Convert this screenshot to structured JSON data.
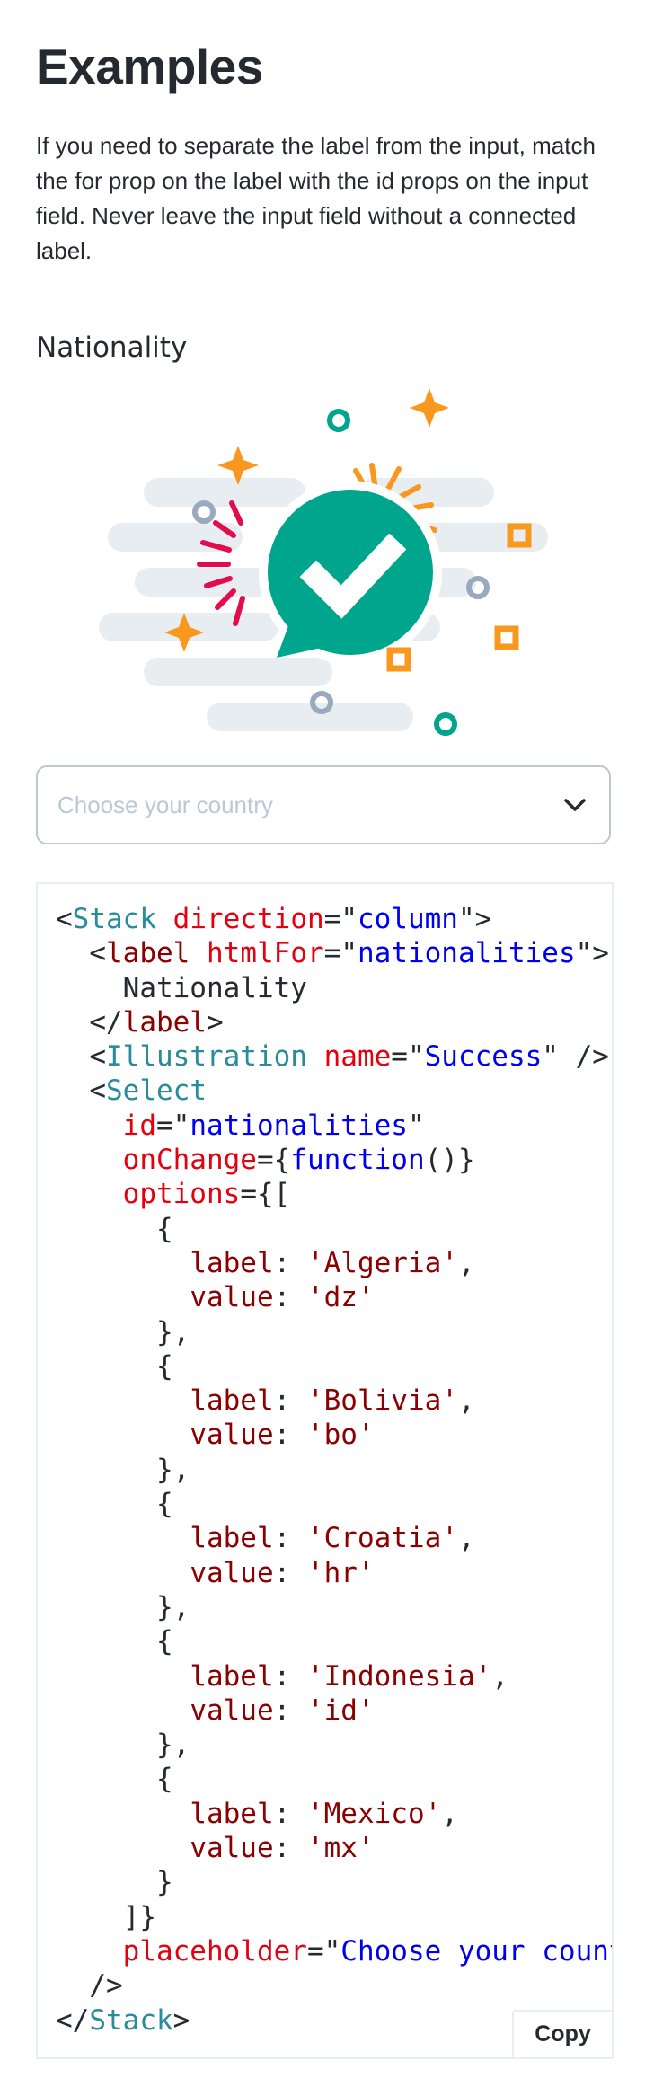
{
  "page": {
    "heading": "Examples",
    "intro": "If you need to separate the label from the input, match the for prop on the label with the id props on the input field. Never leave the input field without a connected label."
  },
  "example": {
    "label": "Nationality",
    "illustration_name": "success-illustration",
    "select": {
      "placeholder": "Choose your country",
      "icon": "chevron-down-icon"
    }
  },
  "code": {
    "copy_label": "Copy",
    "lines": [
      [
        [
          "p",
          "<"
        ],
        [
          "t",
          "Stack"
        ],
        [
          "p",
          " "
        ],
        [
          "a",
          "direction"
        ],
        [
          "p",
          "=\""
        ],
        [
          "s",
          "column"
        ],
        [
          "p",
          "\">"
        ]
      ],
      [
        [
          "p",
          "  <"
        ],
        [
          "q",
          "label"
        ],
        [
          "p",
          " "
        ],
        [
          "a",
          "htmlFor"
        ],
        [
          "p",
          "=\""
        ],
        [
          "s",
          "nationalities"
        ],
        [
          "p",
          "\">"
        ]
      ],
      [
        [
          "p",
          "    Nationality"
        ]
      ],
      [
        [
          "p",
          "  </"
        ],
        [
          "q",
          "label"
        ],
        [
          "p",
          ">"
        ]
      ],
      [
        [
          "p",
          "  <"
        ],
        [
          "t",
          "Illustration"
        ],
        [
          "p",
          " "
        ],
        [
          "a",
          "name"
        ],
        [
          "p",
          "=\""
        ],
        [
          "s",
          "Success"
        ],
        [
          "p",
          "\" />"
        ]
      ],
      [
        [
          "p",
          "  <"
        ],
        [
          "t",
          "Select"
        ]
      ],
      [
        [
          "p",
          "    "
        ],
        [
          "a",
          "id"
        ],
        [
          "p",
          "=\""
        ],
        [
          "s",
          "nationalities"
        ],
        [
          "p",
          "\""
        ]
      ],
      [
        [
          "p",
          "    "
        ],
        [
          "a",
          "onChange"
        ],
        [
          "p",
          "={"
        ],
        [
          "s",
          "function"
        ],
        [
          "p",
          "()}"
        ]
      ],
      [
        [
          "p",
          "    "
        ],
        [
          "a",
          "options"
        ],
        [
          "p",
          "={["
        ]
      ],
      [
        [
          "p",
          "      {"
        ]
      ],
      [
        [
          "p",
          "        "
        ],
        [
          "q",
          "label"
        ],
        [
          "p",
          ": "
        ],
        [
          "q",
          "'Algeria'"
        ],
        [
          "p",
          ","
        ]
      ],
      [
        [
          "p",
          "        "
        ],
        [
          "q",
          "value"
        ],
        [
          "p",
          ": "
        ],
        [
          "q",
          "'dz'"
        ]
      ],
      [
        [
          "p",
          "      },"
        ]
      ],
      [
        [
          "p",
          "      {"
        ]
      ],
      [
        [
          "p",
          "        "
        ],
        [
          "q",
          "label"
        ],
        [
          "p",
          ": "
        ],
        [
          "q",
          "'Bolivia'"
        ],
        [
          "p",
          ","
        ]
      ],
      [
        [
          "p",
          "        "
        ],
        [
          "q",
          "value"
        ],
        [
          "p",
          ": "
        ],
        [
          "q",
          "'bo'"
        ]
      ],
      [
        [
          "p",
          "      },"
        ]
      ],
      [
        [
          "p",
          "      {"
        ]
      ],
      [
        [
          "p",
          "        "
        ],
        [
          "q",
          "label"
        ],
        [
          "p",
          ": "
        ],
        [
          "q",
          "'Croatia'"
        ],
        [
          "p",
          ","
        ]
      ],
      [
        [
          "p",
          "        "
        ],
        [
          "q",
          "value"
        ],
        [
          "p",
          ": "
        ],
        [
          "q",
          "'hr'"
        ]
      ],
      [
        [
          "p",
          "      },"
        ]
      ],
      [
        [
          "p",
          "      {"
        ]
      ],
      [
        [
          "p",
          "        "
        ],
        [
          "q",
          "label"
        ],
        [
          "p",
          ": "
        ],
        [
          "q",
          "'Indonesia'"
        ],
        [
          "p",
          ","
        ]
      ],
      [
        [
          "p",
          "        "
        ],
        [
          "q",
          "value"
        ],
        [
          "p",
          ": "
        ],
        [
          "q",
          "'id'"
        ]
      ],
      [
        [
          "p",
          "      },"
        ]
      ],
      [
        [
          "p",
          "      {"
        ]
      ],
      [
        [
          "p",
          "        "
        ],
        [
          "q",
          "label"
        ],
        [
          "p",
          ": "
        ],
        [
          "q",
          "'Mexico'"
        ],
        [
          "p",
          ","
        ]
      ],
      [
        [
          "p",
          "        "
        ],
        [
          "q",
          "value"
        ],
        [
          "p",
          ": "
        ],
        [
          "q",
          "'mx'"
        ]
      ],
      [
        [
          "p",
          "      }"
        ]
      ],
      [
        [
          "p",
          "    ]}"
        ]
      ],
      [
        [
          "p",
          "    "
        ],
        [
          "a",
          "placeholder"
        ],
        [
          "p",
          "=\""
        ],
        [
          "s",
          "Choose your country"
        ],
        [
          "p",
          "\""
        ]
      ],
      [
        [
          "p",
          "  />"
        ]
      ],
      [
        [
          "p",
          "</"
        ],
        [
          "t",
          "Stack"
        ],
        [
          "p",
          ">"
        ]
      ]
    ]
  },
  "colors": {
    "text": "#252a31",
    "success_green": "#00a58e",
    "cloud_gray": "#e8edf1",
    "accent_orange": "#f9971e",
    "accent_red": "#e30d4d",
    "code_tag": "#2a8b9a",
    "code_attr": "#e3010f",
    "code_string": "#0000ee",
    "code_quoted": "#8b0000"
  }
}
